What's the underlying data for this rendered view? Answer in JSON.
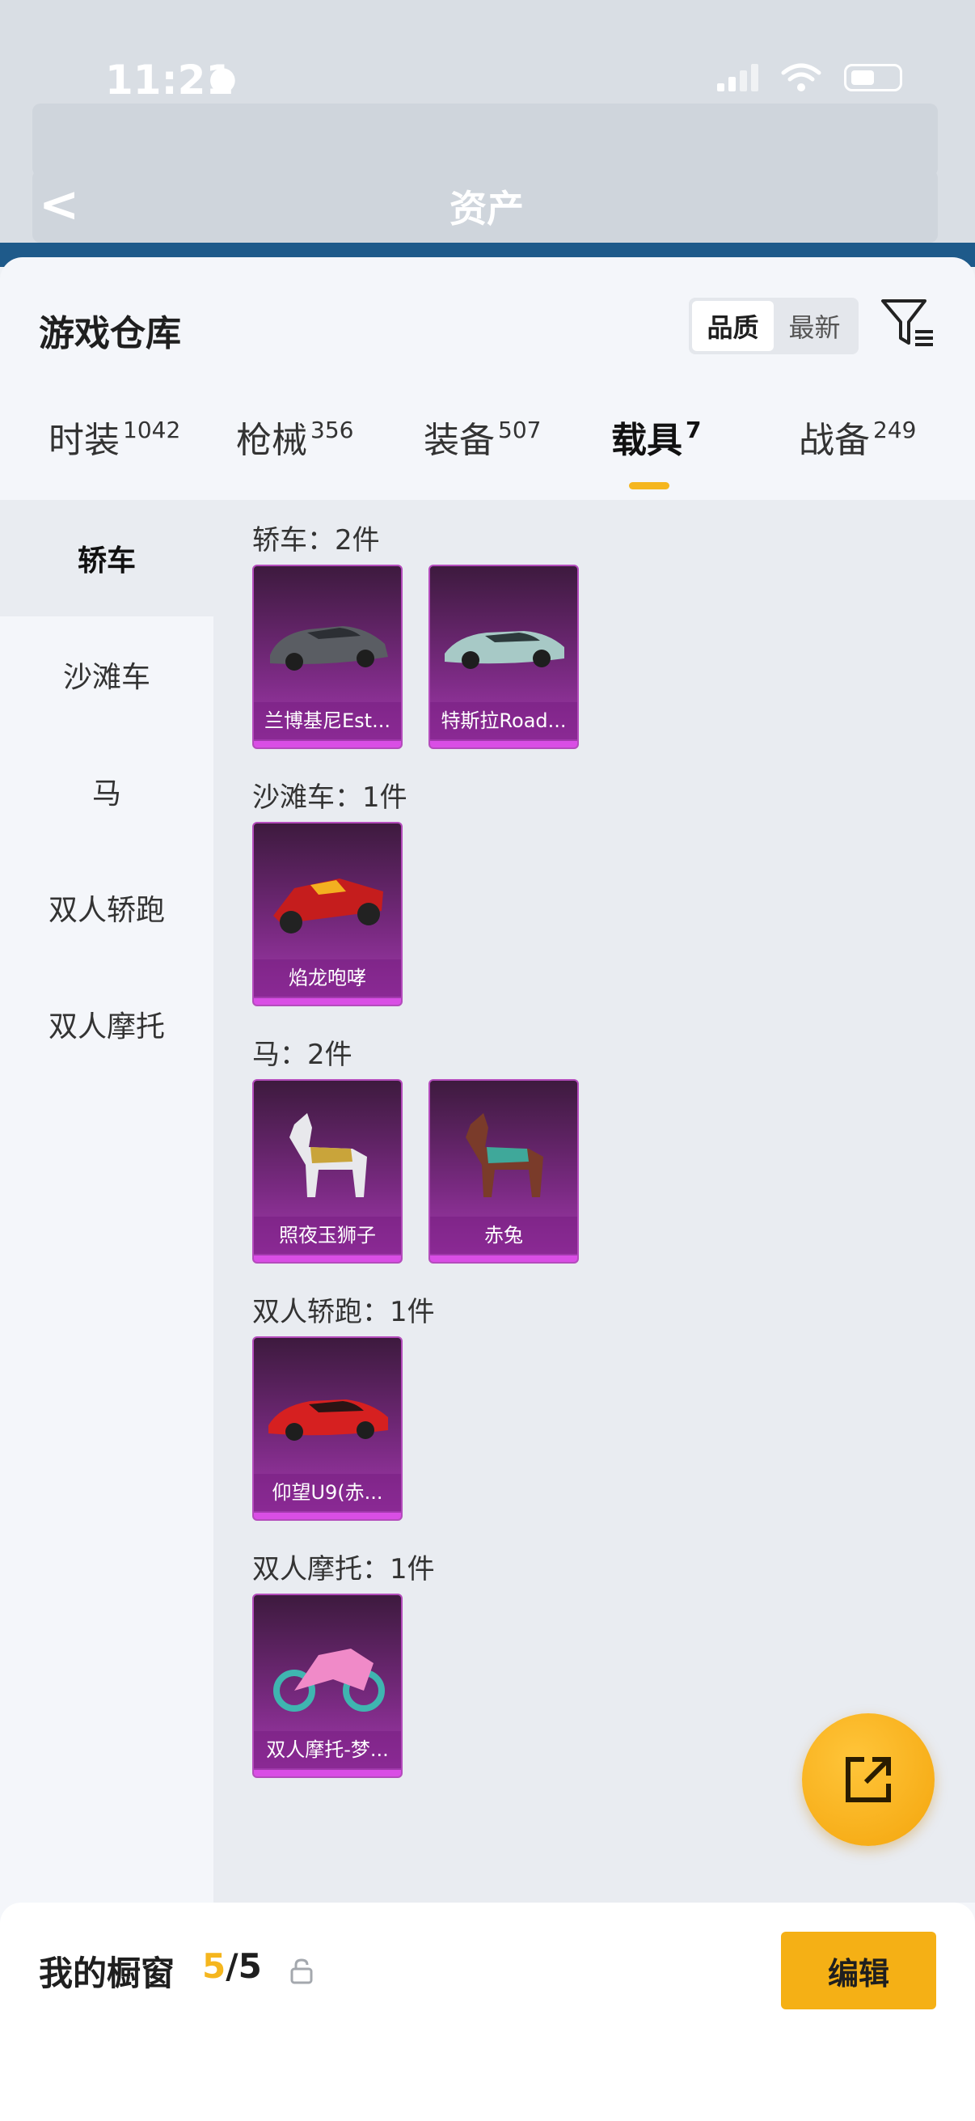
{
  "status_bar": {
    "time": "11:21"
  },
  "background_header": {
    "title": "资产"
  },
  "sheet": {
    "title": "游戏仓库",
    "sort": {
      "options": [
        "品质",
        "最新"
      ],
      "selected": "品质"
    }
  },
  "tabs": [
    {
      "label": "时装",
      "count": "1042"
    },
    {
      "label": "枪械",
      "count": "356"
    },
    {
      "label": "装备",
      "count": "507"
    },
    {
      "label": "载具",
      "count": "7",
      "active": true
    },
    {
      "label": "战备",
      "count": "249"
    }
  ],
  "sidebar": [
    {
      "label": "轿车",
      "active": true
    },
    {
      "label": "沙滩车"
    },
    {
      "label": "马"
    },
    {
      "label": "双人轿跑"
    },
    {
      "label": "双人摩托"
    }
  ],
  "sections": [
    {
      "title": "轿车：2件",
      "items": [
        {
          "label": "兰博基尼Est..."
        },
        {
          "label": "特斯拉Road..."
        }
      ]
    },
    {
      "title": "沙滩车：1件",
      "items": [
        {
          "label": "焰龙咆哮"
        }
      ]
    },
    {
      "title": "马：2件",
      "items": [
        {
          "label": "照夜玉狮子"
        },
        {
          "label": "赤兔"
        }
      ]
    },
    {
      "title": "双人轿跑：1件",
      "items": [
        {
          "label": "仰望U9(赤..."
        }
      ]
    },
    {
      "title": "双人摩托：1件",
      "items": [
        {
          "label": "双人摩托-梦..."
        }
      ]
    }
  ],
  "bottom_bar": {
    "title": "我的橱窗",
    "current": "5",
    "separator_total": "/5",
    "edit_label": "编辑"
  },
  "colors": {
    "accent": "#f5b61e",
    "card_purple": "#a53bb0",
    "edit_button": "#f5b015"
  }
}
